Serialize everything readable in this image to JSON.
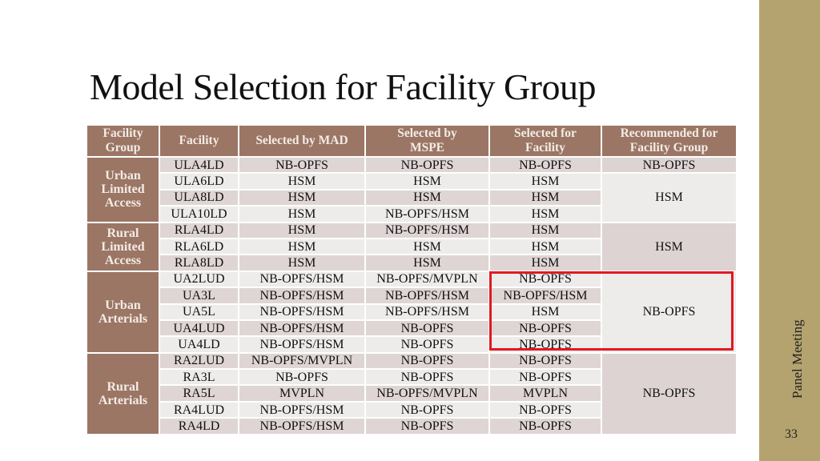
{
  "slide": {
    "title": "Model Selection for Facility Group",
    "footer": "Panel Meeting",
    "page_number": "33"
  },
  "colors": {
    "header_bg": "#9b7665",
    "sidebar_bg": "#b5a36f",
    "highlight": "#e0191f"
  },
  "table": {
    "headers": [
      "Facility Group",
      "Facility",
      "Selected by MAD",
      "Selected by MSPE",
      "Selected for Facility",
      "Recommended for Facility Group"
    ],
    "header_lines": [
      [
        "Facility",
        "Group"
      ],
      [
        "Facility"
      ],
      [
        "Selected by MAD"
      ],
      [
        "Selected by",
        "MSPE"
      ],
      [
        "Selected for",
        "Facility"
      ],
      [
        "Recommended for",
        "Facility Group"
      ]
    ],
    "groups": [
      {
        "name_lines": [
          "Urban",
          "Limited",
          "Access"
        ],
        "rows": [
          {
            "facility": "ULA4LD",
            "mad": "NB-OPFS",
            "mspe": "NB-OPFS",
            "selected": "NB-OPFS"
          },
          {
            "facility": "ULA6LD",
            "mad": "HSM",
            "mspe": "HSM",
            "selected": "HSM"
          },
          {
            "facility": "ULA8LD",
            "mad": "HSM",
            "mspe": "HSM",
            "selected": "HSM"
          },
          {
            "facility": "ULA10LD",
            "mad": "HSM",
            "mspe": "NB-OPFS/HSM",
            "selected": "HSM"
          }
        ],
        "recommended": [
          {
            "value": "NB-OPFS",
            "span": 1
          },
          {
            "value": "HSM",
            "span": 3
          }
        ]
      },
      {
        "name_lines": [
          "Rural",
          "Limited",
          "Access"
        ],
        "rows": [
          {
            "facility": "RLA4LD",
            "mad": "HSM",
            "mspe": "NB-OPFS/HSM",
            "selected": "HSM"
          },
          {
            "facility": "RLA6LD",
            "mad": "HSM",
            "mspe": "HSM",
            "selected": "HSM"
          },
          {
            "facility": "RLA8LD",
            "mad": "HSM",
            "mspe": "HSM",
            "selected": "HSM"
          }
        ],
        "recommended": [
          {
            "value": "HSM",
            "span": 3
          }
        ]
      },
      {
        "name_lines": [
          "Urban",
          "Arterials"
        ],
        "rows": [
          {
            "facility": "UA2LUD",
            "mad": "NB-OPFS/HSM",
            "mspe": "NB-OPFS/MVPLN",
            "selected": "NB-OPFS"
          },
          {
            "facility": "UA3L",
            "mad": "NB-OPFS/HSM",
            "mspe": "NB-OPFS/HSM",
            "selected": "NB-OPFS/HSM"
          },
          {
            "facility": "UA5L",
            "mad": "NB-OPFS/HSM",
            "mspe": "NB-OPFS/HSM",
            "selected": "HSM"
          },
          {
            "facility": "UA4LUD",
            "mad": "NB-OPFS/HSM",
            "mspe": "NB-OPFS",
            "selected": "NB-OPFS"
          },
          {
            "facility": "UA4LD",
            "mad": "NB-OPFS/HSM",
            "mspe": "NB-OPFS",
            "selected": "NB-OPFS"
          }
        ],
        "recommended": [
          {
            "value": "NB-OPFS",
            "span": 5
          }
        ]
      },
      {
        "name_lines": [
          "Rural",
          "Arterials"
        ],
        "rows": [
          {
            "facility": "RA2LUD",
            "mad": "NB-OPFS/MVPLN",
            "mspe": "NB-OPFS",
            "selected": "NB-OPFS"
          },
          {
            "facility": "RA3L",
            "mad": "NB-OPFS",
            "mspe": "NB-OPFS",
            "selected": "NB-OPFS"
          },
          {
            "facility": "RA5L",
            "mad": "MVPLN",
            "mspe": "NB-OPFS/MVPLN",
            "selected": "MVPLN"
          },
          {
            "facility": "RA4LUD",
            "mad": "NB-OPFS/HSM",
            "mspe": "NB-OPFS",
            "selected": "NB-OPFS"
          },
          {
            "facility": "RA4LD",
            "mad": "NB-OPFS/HSM",
            "mspe": "NB-OPFS",
            "selected": "NB-OPFS"
          }
        ],
        "recommended": [
          {
            "value": "NB-OPFS",
            "span": 5
          }
        ]
      }
    ],
    "highlighted_region": "Urban Arterials: Selected for Facility and Recommended for Facility Group"
  }
}
